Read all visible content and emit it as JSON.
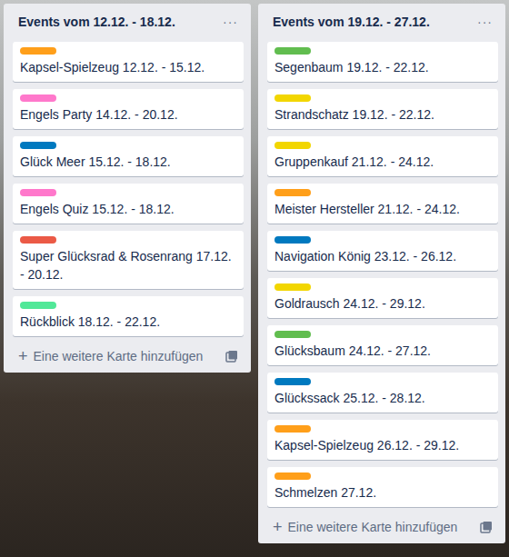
{
  "lists": [
    {
      "title": "Events vom 12.12. - 18.12.",
      "menu": "···",
      "cards": [
        {
          "text": "Kapsel-Spielzeug 12.12. - 15.12.",
          "color": "#ff9f1a"
        },
        {
          "text": "Engels Party 14.12. - 20.12.",
          "color": "#ff78cb"
        },
        {
          "text": "Glück Meer 15.12. - 18.12.",
          "color": "#0079bf"
        },
        {
          "text": "Engels Quiz 15.12. - 18.12.",
          "color": "#ff78cb"
        },
        {
          "text": "Super Glücksrad & Rosenrang 17.12. - 20.12.",
          "color": "#eb5a46"
        },
        {
          "text": "Rückblick 18.12. - 22.12.",
          "color": "#51e898"
        }
      ],
      "add_card": {
        "icon": "+",
        "label": "Eine weitere Karte hinzufügen"
      }
    },
    {
      "title": "Events vom 19.12. - 27.12.",
      "menu": "···",
      "cards": [
        {
          "text": "Segenbaum 19.12. - 22.12.",
          "color": "#61bd4f"
        },
        {
          "text": "Strandschatz 19.12. - 22.12.",
          "color": "#f2d600"
        },
        {
          "text": "Gruppenkauf 21.12. - 24.12.",
          "color": "#f2d600"
        },
        {
          "text": "Meister Hersteller 21.12. - 24.12.",
          "color": "#ff9f1a"
        },
        {
          "text": "Navigation König 23.12. - 26.12.",
          "color": "#0079bf"
        },
        {
          "text": "Goldrausch 24.12. - 29.12.",
          "color": "#f2d600"
        },
        {
          "text": "Glücksbaum 24.12. - 27.12.",
          "color": "#61bd4f"
        },
        {
          "text": "Glückssack 25.12. - 28.12.",
          "color": "#0079bf"
        },
        {
          "text": "Kapsel-Spielzeug 26.12. - 29.12.",
          "color": "#ff9f1a"
        },
        {
          "text": "Schmelzen 27.12.",
          "color": "#ff9f1a"
        }
      ],
      "add_card": {
        "icon": "+",
        "label": "Eine weitere Karte hinzufügen"
      }
    }
  ]
}
